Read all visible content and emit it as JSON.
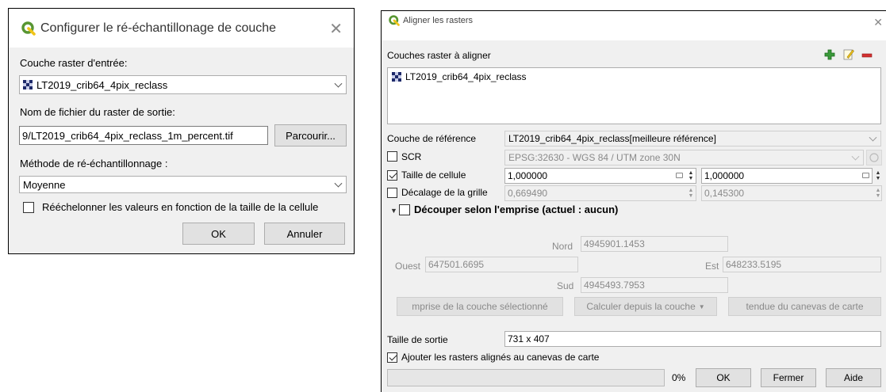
{
  "dialog1": {
    "title": "Configurer le ré-échantillonage de couche",
    "input_label": "Couche raster d'entrée:",
    "input_layer": "LT2019_crib64_4pix_reclass",
    "output_label": "Nom de fichier du raster de sortie:",
    "output_path": "9/LT2019_crib64_4pix_reclass_1m_percent.tif",
    "browse_label": "Parcourir...",
    "method_label": "Méthode de ré-échantillonnage :",
    "method_value": "Moyenne",
    "rescale_label": "Rééchelonner les valeurs en fonction de la taille de la cellule",
    "ok_label": "OK",
    "cancel_label": "Annuler"
  },
  "dialog2": {
    "title": "Aligner les rasters",
    "list_label": "Couches raster à aligner",
    "list_items": [
      "LT2019_crib64_4pix_reclass"
    ],
    "ref_label": "Couche de référence",
    "ref_value": "LT2019_crib64_4pix_reclass[meilleure référence]",
    "scr_label": "SCR",
    "scr_value": "EPSG:32630 - WGS 84 / UTM zone 30N",
    "cell_label": "Taille de cellule",
    "cell_x": "1,000000",
    "cell_y": "1,000000",
    "offset_label": "Décalage de la grille",
    "offset_x": "0,669490",
    "offset_y": "0,145300",
    "clip_label": "Découper selon l'emprise (actuel : aucun)",
    "north_label": "Nord",
    "north_value": "4945901.1453",
    "west_label": "Ouest",
    "west_value": "647501.6695",
    "east_label": "Est",
    "east_value": "648233.5195",
    "south_label": "Sud",
    "south_value": "4945493.7953",
    "btn_layer_extent": "mprise de la couche sélectionné",
    "btn_calc_from_layer": "Calculer depuis la couche",
    "btn_canvas_extent": "tendue du canevas de carte",
    "output_size_label": "Taille de sortie",
    "output_size_value": "731 x 407",
    "add_to_canvas_label": "Ajouter les rasters alignés au canevas de carte",
    "progress_text": "0%",
    "progress": 0,
    "ok_label": "OK",
    "close_label": "Fermer",
    "help_label": "Aide"
  },
  "colors": {
    "qgis_green": "#589632",
    "qgis_yellow": "#f0c419",
    "add_green": "#3a9a3a",
    "remove_red": "#d23030"
  }
}
